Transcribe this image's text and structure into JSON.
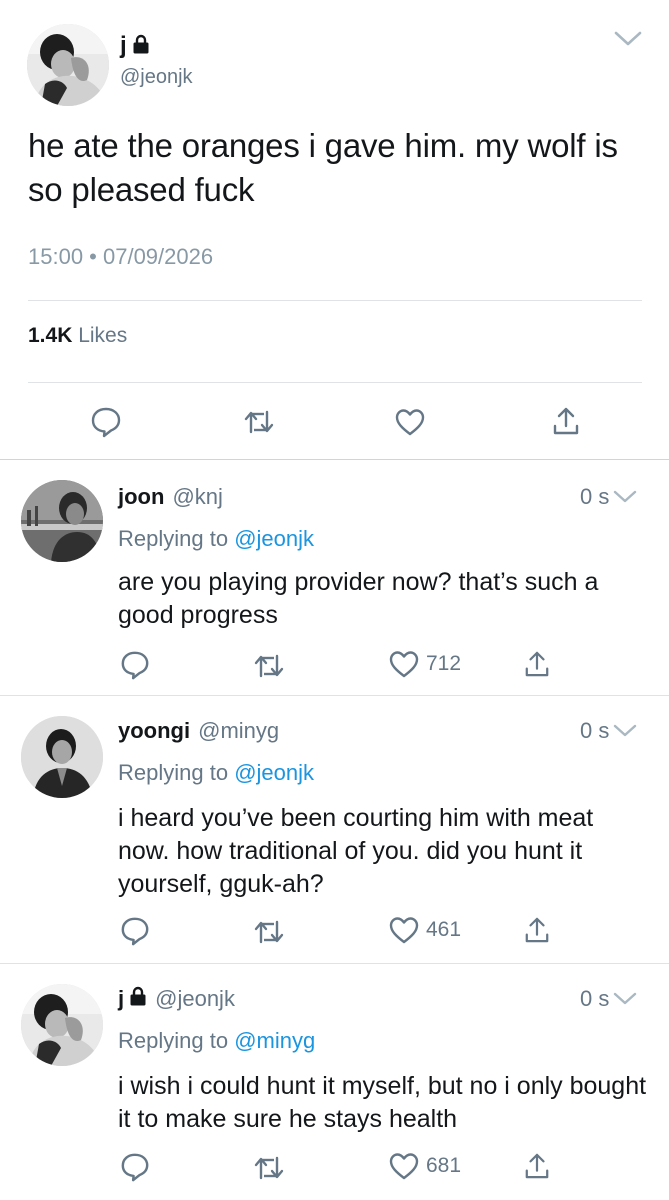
{
  "main_tweet": {
    "author_name": "j",
    "author_handle": "@jeonjk",
    "text": "he ate the oranges i gave him. my wolf is so pleased fuck",
    "timestamp": "15:00 • 07/09/2026",
    "likes_count": "1.4K",
    "likes_label": "Likes",
    "icons": [
      "reply-icon",
      "retweet-icon",
      "like-icon",
      "share-icon",
      "lock-icon",
      "chevron-down-icon"
    ]
  },
  "replies": [
    {
      "name": "joon",
      "handle": "@knj",
      "time_ago": "0 s",
      "replying_prefix": "Replying to",
      "replying_to": "@jeonjk",
      "text": "are you playing provider now? that’s such a good progress",
      "likes": "712"
    },
    {
      "name": "yoongi",
      "handle": "@minyg",
      "time_ago": "0 s",
      "replying_prefix": "Replying to",
      "replying_to": "@jeonjk",
      "text": "i heard you’ve been courting him with meat now. how traditional of you. did you hunt it yourself, gguk-ah?",
      "likes": "461"
    },
    {
      "name": "j",
      "handle": "@jeonjk",
      "time_ago": "0 s",
      "replying_prefix": "Replying to",
      "replying_to": "@minyg",
      "text": "i wish i could hunt it myself, but no i only bought it to make sure he stays health",
      "likes": "681"
    }
  ],
  "colors": {
    "text": "#14171a",
    "secondary": "#657786",
    "link": "#1b95e0",
    "divider": "#dfe3e6"
  }
}
